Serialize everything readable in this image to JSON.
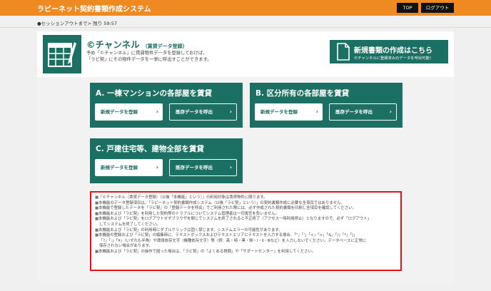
{
  "header": {
    "app_title": "ラビーネット契約書類作成システム",
    "top_label": "TOP",
    "logout_label": "ログアウト"
  },
  "session": {
    "text": "●セッションアウトまで> 残り 59:57"
  },
  "channel": {
    "title": "©チャンネル",
    "subtitle": "（賃貸データ登録）",
    "desc_line1": "予め「©チャンネル」に賃貸物件データを登録しておけば、",
    "desc_line2": "「ラビ契」にその物件データを一挙に呼出すことができます。"
  },
  "new_doc": {
    "title": "新規書類の作成はこちら",
    "sub": "©チャンネルに登録済みのデータを呼出可能！"
  },
  "sections": [
    {
      "title": "A. 一棟マンションの各部屋を賃貸",
      "new_label": "新規データを登録",
      "load_label": "既存データを呼出"
    },
    {
      "title": "B. 区分所有の各部屋を賃貸",
      "new_label": "新規データを登録",
      "load_label": "既存データを呼出"
    },
    {
      "title": "C. 戸建住宅等、建物全部を賃貸",
      "new_label": "新規データを登録",
      "load_label": "既存データを呼出"
    }
  ],
  "chevron": "›",
  "notes": [
    "「©チャンネル（賃貸データ登録）（以後「本機能」という）」の利用対象は賃貸物件に限ります。",
    "本機能のデータ登録項目は、「ラビーネット契約書類作成システム（以後「ラビ契」という）」の契約書類作成に必要な全項目ではありません。",
    "本機能で登録したデータを「ラビ契」の「登録データを呼出」でご利用された際には、必ず作成された契約書類を印刷し全項目を確認してください。",
    "本機能および「ラビ契」を利用した契約等のトラブルについてシステム管理者は一切責任を負いません。",
    "本機能および「ラビ契」をログアウトせずブラウザを閉じてシステムを終了されると不正終了（アクセス一時利用停止）となりますので、必ず「ログアウト」",
    "してシステムを終了してください。",
    "本機能および「ラビ契」の利用時にダブルクリックは固く禁じます。システムエラーの可能性があります。",
    "本機能の登録および「ラビ契」の編集時に、テキストボックスおよびテキストエリアにテキストを入力する場合、「\"」「'」「<」「>」「&」「/」「*」「|」",
    "「?」「:」「¥」（いずれも半角）や環境依存文字（機種依存文字）等（例：髙・﨑・黒・㈱・Ⅰ・Ⅱ・Ⅲなど）を入力しないでください。データベースに正常に",
    "保存されない場合があります。",
    "本機能および「ラビ契」の操作で困った場合は、「ラビ契」の「よくある質問」や「サポートセンター」を利用してください。"
  ],
  "note_bullets": [
    "■",
    "■",
    "■",
    "■",
    "■",
    "",
    "■",
    "■",
    "",
    "",
    "■"
  ]
}
